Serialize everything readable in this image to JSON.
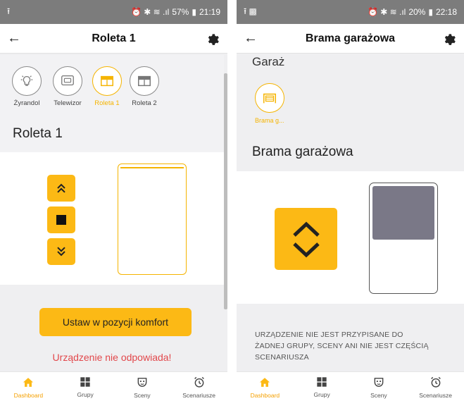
{
  "left": {
    "status": {
      "battery": "57%",
      "time": "21:19"
    },
    "title": "Roleta 1",
    "devices": [
      {
        "label": "Żyrandol",
        "icon": "lightbulb-icon",
        "active": false
      },
      {
        "label": "Telewizor",
        "icon": "tv-icon",
        "active": false
      },
      {
        "label": "Roleta 1",
        "icon": "blind-icon",
        "active": true
      },
      {
        "label": "Roleta 2",
        "icon": "blind-icon",
        "active": false
      }
    ],
    "section_title": "Roleta 1",
    "komfort_label": "Ustaw w pozycji komfort",
    "error_text": "Urządzenie nie odpowiada!"
  },
  "right": {
    "status": {
      "battery": "20%",
      "time": "22:18"
    },
    "title": "Brama garażowa",
    "group_title": "Garaż",
    "device_label": "Brama g...",
    "section_title": "Brama garażowa",
    "info_lines": [
      "URZĄDZENIE NIE JEST PRZYPISANE DO",
      "ŻADNEJ GRUPY, SCENY ANI NIE JEST CZĘŚCIĄ",
      "SCENARIUSZA"
    ]
  },
  "nav": [
    {
      "label": "Dashboard",
      "icon": "home-icon"
    },
    {
      "label": "Grupy",
      "icon": "grid-icon"
    },
    {
      "label": "Sceny",
      "icon": "mask-icon"
    },
    {
      "label": "Scenariusze",
      "icon": "alarm-clock-icon"
    }
  ],
  "colors": {
    "accent": "#fcb915",
    "error": "#e2474b",
    "gate_fill": "#7a7887"
  }
}
